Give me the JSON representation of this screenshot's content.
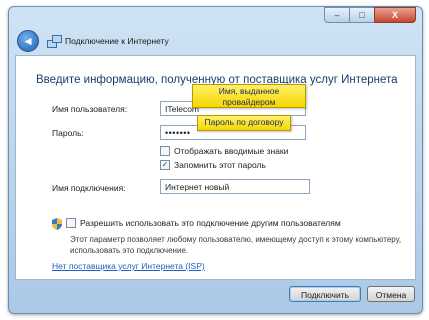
{
  "window": {
    "title": "Подключение к Интернету",
    "minimize_glyph": "–",
    "maximize_glyph": "□",
    "close_glyph": "X"
  },
  "nav": {
    "back_glyph": "◄"
  },
  "content": {
    "heading": "Введите информацию, полученную от поставщика услуг Интернета",
    "username_label": "Имя пользователя:",
    "username_value": "ITelecom",
    "password_label": "Пароль:",
    "password_value": "•••••••",
    "show_chars_label": "Отображать вводимые знаки",
    "show_chars_checked": false,
    "remember_label": "Запомнить этот пароль",
    "remember_checked": true,
    "connection_name_label": "Имя подключения:",
    "connection_name_value": "Интернет новый",
    "allow_others_label": "Разрешить использовать это подключение другим пользователям",
    "allow_others_checked": false,
    "allow_others_desc": "Этот параметр позволяет любому пользователю, имеющему доступ к этому компьютеру, использовать это подключение.",
    "no_isp_link": "Нет поставщика услуг Интернета (ISP)"
  },
  "callouts": {
    "username_hint": "Имя, выданное провайдером",
    "password_hint": "Пароль по договору"
  },
  "buttons": {
    "connect": "Подключить",
    "cancel": "Отмена"
  },
  "colors": {
    "heading": "#1c3c6e",
    "link": "#1f5fbf",
    "callout": "#f5d700"
  }
}
